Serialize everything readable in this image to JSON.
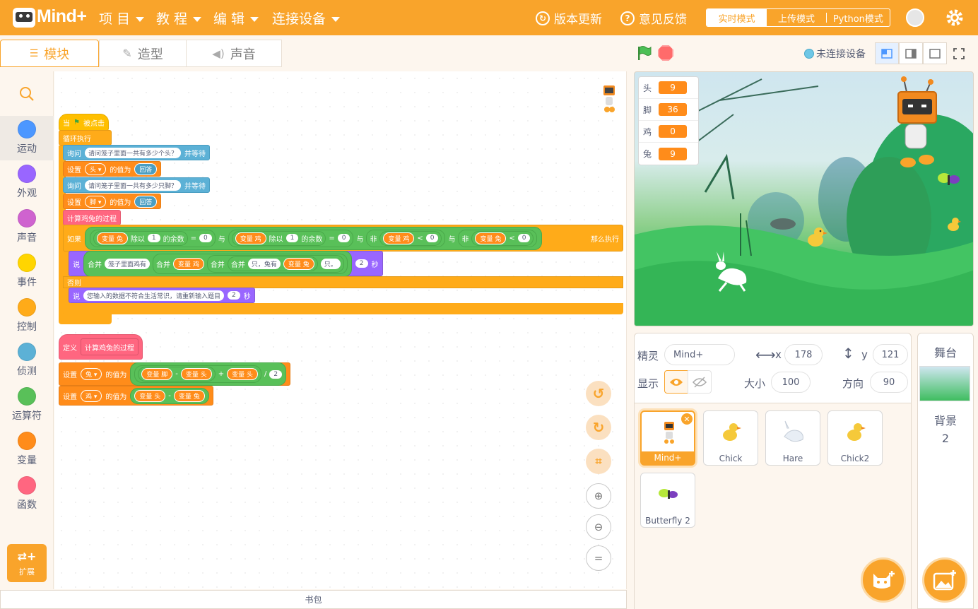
{
  "app": {
    "logo_text": "Mind+"
  },
  "menu": [
    {
      "label": "项 目"
    },
    {
      "label": "教 程"
    },
    {
      "label": "编 辑"
    },
    {
      "label": "连接设备"
    }
  ],
  "top_links": {
    "update": "版本更新",
    "feedback": "意见反馈"
  },
  "modes": {
    "realtime": "实时模式",
    "upload": "上传模式",
    "python": "Python模式",
    "active": "实时模式"
  },
  "tabs": {
    "blocks": "模块",
    "costumes": "造型",
    "sounds": "声音",
    "active": "模块"
  },
  "categories": [
    {
      "label": "运动",
      "color": "#4c97ff"
    },
    {
      "label": "外观",
      "color": "#9966ff"
    },
    {
      "label": "声音",
      "color": "#cf63cf"
    },
    {
      "label": "事件",
      "color": "#ffd500"
    },
    {
      "label": "控制",
      "color": "#ffab19"
    },
    {
      "label": "侦测",
      "color": "#5cb1d6"
    },
    {
      "label": "运算符",
      "color": "#59c059"
    },
    {
      "label": "变量",
      "color": "#ff8c1a"
    },
    {
      "label": "函数",
      "color": "#ff6680"
    }
  ],
  "extension_label": "扩展",
  "backpack_label": "书包",
  "script": {
    "when_flag": {
      "when": "当",
      "clicked": "被点击"
    },
    "forever": "循环执行",
    "ask1": {
      "ask": "询问",
      "question": "请问笼子里面一共有多少个头？",
      "wait": "并等待"
    },
    "set_head": {
      "set": "设置",
      "var": "头",
      "to": "的值为",
      "value": "回答"
    },
    "ask2": {
      "ask": "询问",
      "question": "请问笼子里面一共有多少只脚？",
      "wait": "并等待"
    },
    "set_foot": {
      "set": "设置",
      "var": "脚",
      "to": "的值为",
      "value": "回答"
    },
    "call": "计算鸡兔的过程",
    "if": {
      "if": "如果",
      "var_rabbit": "变量 兔",
      "mod": "除以",
      "n1": "1",
      "rem": "的余数",
      "eq": "=",
      "z": "0",
      "and": "与",
      "var_chick": "变量 鸡",
      "not": "非",
      "lt": "<",
      "then": "那么执行"
    },
    "say1": {
      "say": "说",
      "join": "合并",
      "text1": "笼子里面鸡有",
      "var_chick": "变量 鸡",
      "text2": "只，兔有",
      "var_rabbit": "变量 兔",
      "text3": "只。",
      "secs": "2",
      "sec_unit": "秒"
    },
    "else": "否则",
    "say2": {
      "say": "说",
      "text": "您输入的数据不符合生活常识，请重新输入题目",
      "secs": "2",
      "sec_unit": "秒"
    },
    "define": {
      "define": "定义",
      "name": "计算鸡兔的过程"
    },
    "set_rabbit": {
      "set": "设置",
      "var": "兔",
      "to": "的值为",
      "var_foot": "变量 脚",
      "minus": "-",
      "var_head": "变量 头",
      "plus": "+",
      "div": "/",
      "two": "2"
    },
    "set_chick": {
      "set": "设置",
      "var": "鸡",
      "to": "的值为",
      "var_head": "变量 头",
      "minus": "-",
      "var_rabbit": "变量 兔"
    }
  },
  "stage_controls": {
    "connection": "未连接设备"
  },
  "monitors": [
    {
      "label": "头",
      "value": "9"
    },
    {
      "label": "脚",
      "value": "36"
    },
    {
      "label": "鸡",
      "value": "0"
    },
    {
      "label": "兔",
      "value": "9"
    }
  ],
  "sprite_info": {
    "sprite_label": "精灵",
    "sprite_name": "Mind+",
    "x_label": "x",
    "x": "178",
    "y_label": "y",
    "y": "121",
    "show_label": "显示",
    "size_label": "大小",
    "size": "100",
    "direction_label": "方向",
    "direction": "90"
  },
  "sprites": [
    {
      "name": "Mind+",
      "icon": "robot-icon"
    },
    {
      "name": "Chick",
      "icon": "chick-icon"
    },
    {
      "name": "Hare",
      "icon": "hare-icon"
    },
    {
      "name": "Chick2",
      "icon": "chick-icon"
    },
    {
      "name": "Butterfly 2",
      "icon": "butterfly-icon"
    }
  ],
  "stage_panel": {
    "title": "舞台",
    "backdrop_label": "背景",
    "backdrop_count": "2"
  },
  "colors": {
    "brand": "#f9a42b",
    "control": "#ffab19",
    "variable": "#ff8c1a",
    "sensing": "#5cb1d6",
    "looks": "#9966ff",
    "operator": "#59c059",
    "function": "#ff6680"
  }
}
